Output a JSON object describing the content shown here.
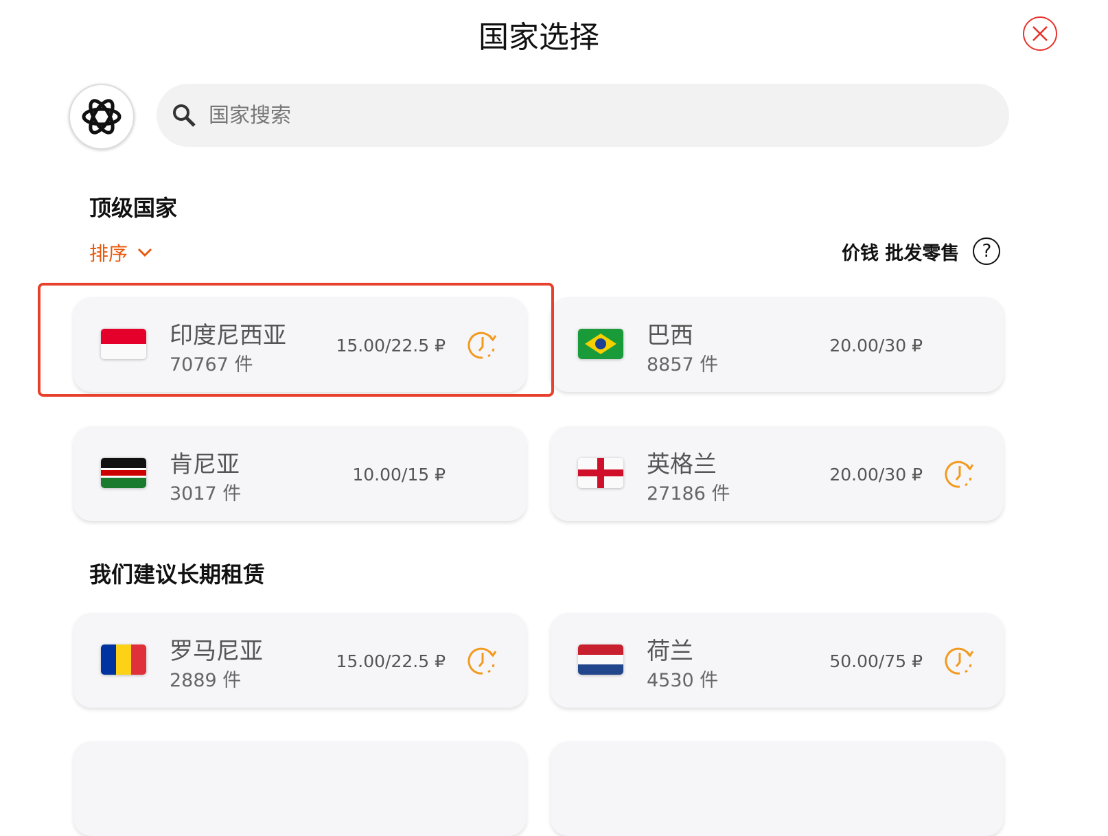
{
  "title": "国家选择",
  "search": {
    "placeholder": "国家搜索"
  },
  "sections": {
    "top": "顶级国家",
    "long_term": "我们建议长期租赁"
  },
  "sort_label": "排序",
  "price_header": "价钱 批发零售",
  "accent": "#e8590c",
  "cards": [
    {
      "name": "印度尼西亚",
      "count": "70767 件",
      "price": "15.00/22.5 ₽",
      "clock": true,
      "selected": true
    },
    {
      "name": "巴西",
      "count": "8857 件",
      "price": "20.00/30 ₽",
      "clock": false
    },
    {
      "name": "肯尼亚",
      "count": "3017 件",
      "price": "10.00/15 ₽",
      "clock": false
    },
    {
      "name": "英格兰",
      "count": "27186 件",
      "price": "20.00/30 ₽",
      "clock": true
    },
    {
      "name": "罗马尼亚",
      "count": "2889 件",
      "price": "15.00/22.5 ₽",
      "clock": true
    },
    {
      "name": "荷兰",
      "count": "4530 件",
      "price": "50.00/75 ₽",
      "clock": true
    }
  ]
}
